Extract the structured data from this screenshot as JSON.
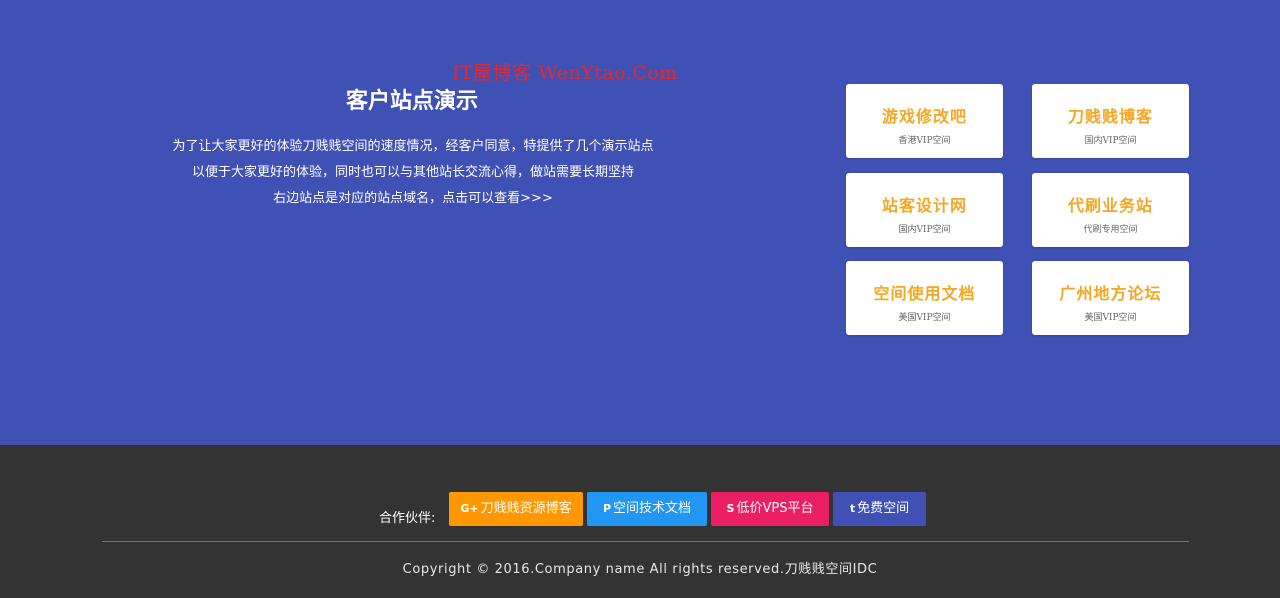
{
  "watermark": "IT屋博客 WenYtao.Com",
  "hero": {
    "title": "客户站点演示",
    "lines": [
      "为了让大家更好的体验刀贱贱空间的速度情况，经客户同意，特提供了几个演示站点",
      "以便于大家更好的体验，同时也可以与其他站长交流心得，做站需要长期坚持",
      "右边站点是对应的站点域名，点击可以查看>>>"
    ]
  },
  "sites": [
    {
      "name": "游戏修改吧",
      "sub": "香港VIP空间"
    },
    {
      "name": "刀贱贱博客",
      "sub": "国内VIP空间"
    },
    {
      "name": "站客设计网",
      "sub": "国内VIP空间"
    },
    {
      "name": "代刷业务站",
      "sub": "代刷专用空间"
    },
    {
      "name": "空间使用文档",
      "sub": "美国VIP空间"
    },
    {
      "name": "广州地方论坛",
      "sub": "美国VIP空间"
    }
  ],
  "footer": {
    "partners_label": "合作伙伴:",
    "partners": [
      {
        "icon": "G+",
        "label": "刀贱贱资源博客",
        "color": "#ff9800"
      },
      {
        "icon": "P",
        "label": "空间技术文档",
        "color": "#2196f3"
      },
      {
        "icon": "S",
        "label": "低价VPS平台",
        "color": "#e91e63"
      },
      {
        "icon": "t",
        "label": "免费空间",
        "color": "#3f51b5"
      }
    ],
    "copyright": "Copyright © 2016.Company name All rights reserved.刀贱贱空间IDC"
  },
  "colors": {
    "hero_bg": "#3f51b5",
    "footer_bg": "#333333",
    "card_title": "#f5a623",
    "watermark": "#e8262d"
  }
}
